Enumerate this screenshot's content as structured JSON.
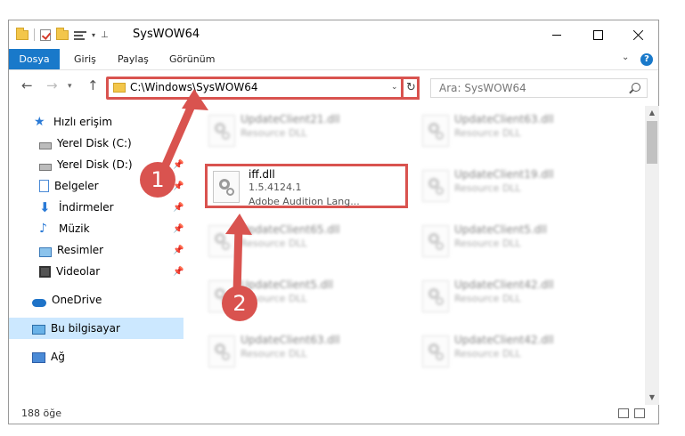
{
  "window": {
    "title": "SysWOW64"
  },
  "ribbon": {
    "tabs": [
      "Dosya",
      "Giriş",
      "Paylaş",
      "Görünüm"
    ],
    "help": "?"
  },
  "address": {
    "path": "C:\\Windows\\SysWOW64",
    "search_placeholder": "Ara: SysWOW64"
  },
  "sidebar": {
    "quick_access": "Hızlı erişim",
    "items": [
      {
        "label": "Yerel Disk (C:)",
        "icon": "disk-icon",
        "pinned": false
      },
      {
        "label": "Yerel Disk (D:)",
        "icon": "disk-icon",
        "pinned": true
      },
      {
        "label": "Belgeler",
        "icon": "documents-icon",
        "pinned": true
      },
      {
        "label": "İndirmeler",
        "icon": "download-icon",
        "pinned": true
      },
      {
        "label": "Müzik",
        "icon": "music-icon",
        "pinned": true
      },
      {
        "label": "Resimler",
        "icon": "pictures-icon",
        "pinned": true
      },
      {
        "label": "Videolar",
        "icon": "videos-icon",
        "pinned": true
      }
    ],
    "onedrive": "OneDrive",
    "this_pc": "Bu bilgisayar",
    "network": "Ağ"
  },
  "files": {
    "highlighted": {
      "name": "iff.dll",
      "version": "1.5.4124.1",
      "description": "Adobe Audition Lang..."
    },
    "left_column": [
      {
        "name": "UpdateClient21.dll",
        "desc": "Resource DLL"
      },
      {
        "name": "UpdateClient65.dll",
        "desc": "Resource DLL"
      },
      {
        "name": "UpdateClient5.dll",
        "desc": "Resource DLL"
      },
      {
        "name": "UpdateClient63.dll",
        "desc": "Resource DLL"
      }
    ],
    "right_column": [
      {
        "name": "UpdateClient63.dll",
        "desc": "Resource DLL"
      },
      {
        "name": "UpdateClient19.dll",
        "desc": "Resource DLL"
      },
      {
        "name": "UpdateClient5.dll",
        "desc": "Resource DLL"
      },
      {
        "name": "UpdateClient42.dll",
        "desc": "Resource DLL"
      },
      {
        "name": "UpdateClient42.dll",
        "desc": "Resource DLL"
      }
    ]
  },
  "status": {
    "item_count": "188 öğe"
  },
  "annotations": {
    "step1": "1",
    "step2": "2",
    "color": "#d9534f"
  }
}
